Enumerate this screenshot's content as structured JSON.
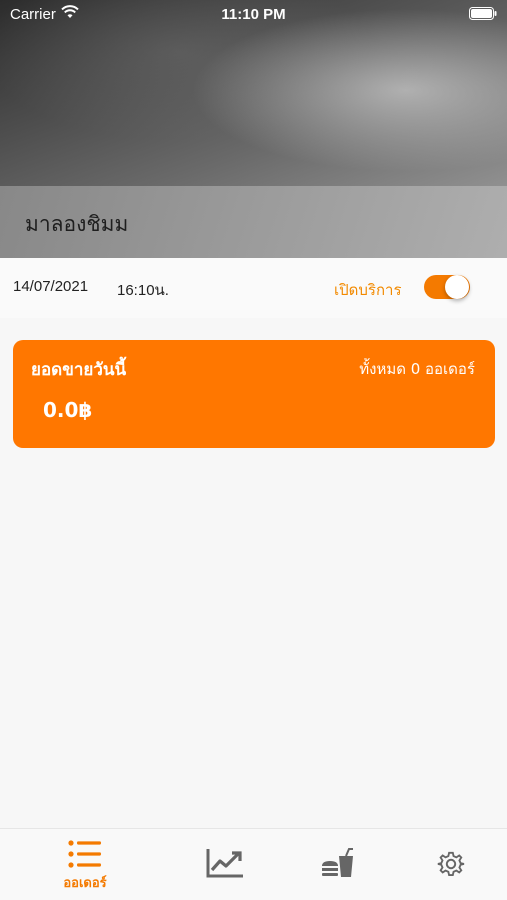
{
  "status_bar": {
    "carrier": "Carrier",
    "time": "11:10 PM"
  },
  "header": {
    "store_name": "มาลองชิมม"
  },
  "info": {
    "date": "14/07/2021",
    "time": "16:10น.",
    "service_label": "เปิดบริการ",
    "service_enabled": true
  },
  "sales": {
    "title": "ยอดขายวันนี้",
    "order_count_text": "ทั้งหมด 0 ออเดอร์",
    "amount": "0.0฿"
  },
  "tabbar": {
    "active_color": "#f47a00",
    "inactive_color": "#666666",
    "tabs": [
      {
        "icon": "list-icon",
        "label": "ออเดอร์",
        "active": true
      },
      {
        "icon": "chart-icon",
        "label": "",
        "active": false
      },
      {
        "icon": "food-drink-icon",
        "label": "",
        "active": false
      },
      {
        "icon": "gear-icon",
        "label": "",
        "active": false
      }
    ]
  },
  "colors": {
    "accent": "#ff7700"
  }
}
